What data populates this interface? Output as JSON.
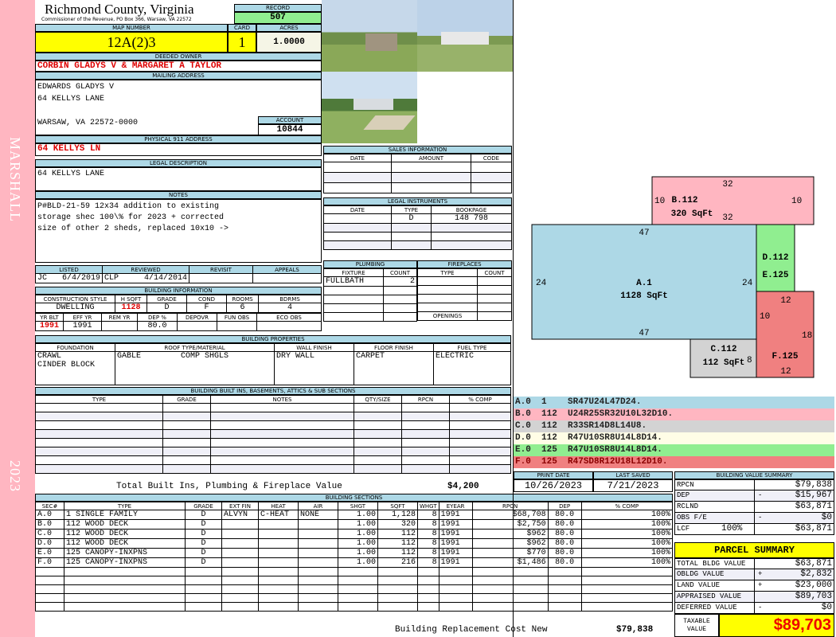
{
  "side": {
    "top": "MARSHALL",
    "bottom": "2023"
  },
  "header": {
    "title": "Richmond County, Virginia",
    "subtitle": "Commissioner of the Revenue, PO Box 366, Warsaw, VA 22572",
    "record_label": "RECORD",
    "record": "507"
  },
  "parcel": {
    "map_label": "MAP NUMBER",
    "map": "12A(2)3",
    "card_label": "CARD",
    "card": "1",
    "acres_label": "ACRES",
    "acres": "1.0000"
  },
  "owner": {
    "label": "DEEDED OWNER",
    "name": "CORBIN GLADYS V & MARGARET A TAYLOR"
  },
  "mailing": {
    "label": "MAILING ADDRESS",
    "line1": "EDWARDS GLADYS V",
    "line2": "64 KELLYS LANE",
    "line3": "WARSAW, VA 22572-0000",
    "account_label": "ACCOUNT",
    "account": "10844"
  },
  "physical": {
    "label": "PHYSICAL 911 ADDRESS",
    "value": "64 KELLYS LN"
  },
  "legal": {
    "label": "LEGAL DESCRIPTION",
    "value": "64 KELLYS LANE"
  },
  "notes": {
    "label": "NOTES",
    "lines": [
      "P#BLD-21-59 12x34 addition to existing",
      "storage shec 100\\% for 2023 + corrected",
      "size of other 2 sheds, replaced 10x10 ->"
    ]
  },
  "review": {
    "listed_label": "LISTED",
    "listed_by": "JC",
    "listed_date": "6/4/2019",
    "reviewed_label": "REVIEWED",
    "reviewed_by": "CLP",
    "reviewed_date": "4/14/2014",
    "revisit_label": "REVISIT",
    "appeals_label": "APPEALS"
  },
  "building_info": {
    "label": "BUILDING INFORMATION",
    "headers1": [
      "CONSTRUCTION STYLE",
      "H SQFT",
      "GRADE",
      "COND",
      "ROOMS",
      "BDRMS"
    ],
    "values1": [
      "DWELLING",
      "1128",
      "D",
      "F",
      "6",
      "4"
    ],
    "headers2": [
      "YR BLT",
      "EFF YR",
      "REM YR",
      "DEP %",
      "DEPOVR",
      "FUN OBS",
      "ECO OBS"
    ],
    "values2": [
      "1991",
      "1991",
      "",
      "80.0",
      "",
      "",
      ""
    ]
  },
  "properties": {
    "label": "BUILDING PROPERTIES",
    "headers": [
      "FOUNDATION",
      "ROOF TYPE/MATERIAL",
      "WALL FINISH",
      "FLOOR FINISH",
      "FUEL TYPE"
    ],
    "foundation": [
      "CRAWL",
      "CINDER BLOCK"
    ],
    "roof_type": "GABLE",
    "roof_material": "COMP SHGLS",
    "wall": "DRY WALL",
    "floor": "CARPET",
    "fuel": "ELECTRIC"
  },
  "builtins": {
    "label": "BUILDING BUILT INS, BASEMENTS, ATTICS & SUB SECTIONS",
    "headers": [
      "TYPE",
      "GRADE",
      "NOTES",
      "QTY/SIZE",
      "RPCN",
      "% COMP"
    ],
    "total_label": "Total Built Ins, Plumbing & Fireplace Value",
    "total": "$4,200"
  },
  "sections": {
    "label": "BUILDING SECTIONS",
    "headers": [
      "SEC#",
      "TYPE",
      "GRADE",
      "EXT FIN",
      "HEAT",
      "AIR",
      "SHGT",
      "SQFT",
      "WHGT",
      "EYEAR",
      "RPCN",
      "DEP",
      "% COMP"
    ],
    "rows": [
      [
        "A.0",
        "1 SINGLE FAMILY",
        "D",
        "ALVYN",
        "C-HEAT",
        "NONE",
        "1.00",
        "1,128",
        "8",
        "1991",
        "$68,708",
        "80.0",
        "100%"
      ],
      [
        "B.0",
        "112 WOOD DECK",
        "D",
        "",
        "",
        "",
        "1.00",
        "320",
        "8",
        "1991",
        "$2,750",
        "80.0",
        "100%"
      ],
      [
        "C.0",
        "112 WOOD DECK",
        "D",
        "",
        "",
        "",
        "1.00",
        "112",
        "8",
        "1991",
        "$962",
        "80.0",
        "100%"
      ],
      [
        "D.0",
        "112 WOOD DECK",
        "D",
        "",
        "",
        "",
        "1.00",
        "112",
        "8",
        "1991",
        "$962",
        "80.0",
        "100%"
      ],
      [
        "E.0",
        "125 CANOPY-INXPNS",
        "D",
        "",
        "",
        "",
        "1.00",
        "112",
        "8",
        "1991",
        "$770",
        "80.0",
        "100%"
      ],
      [
        "F.0",
        "125 CANOPY-INXPNS",
        "D",
        "",
        "",
        "",
        "1.00",
        "216",
        "8",
        "1991",
        "$1,486",
        "80.0",
        "100%"
      ]
    ],
    "total_label": "Building Replacement Cost New",
    "total": "$79,838"
  },
  "sales": {
    "label": "SALES INFORMATION",
    "headers": [
      "DATE",
      "AMOUNT",
      "CODE"
    ]
  },
  "instruments": {
    "label": "LEGAL INSTRUMENTS",
    "headers": [
      "DATE",
      "TYPE",
      "BOOKPAGE"
    ],
    "rows": [
      [
        "",
        "D",
        "148 798"
      ]
    ]
  },
  "plumbing": {
    "label": "PLUMBING",
    "headers": [
      "FIXTURE",
      "COUNT"
    ],
    "rows": [
      [
        "FULLBATH",
        "2"
      ]
    ]
  },
  "fireplaces": {
    "label": "FIREPLACES",
    "headers": [
      "TYPE",
      "COUNT"
    ],
    "openings_label": "OPENINGS"
  },
  "sketch": {
    "A": {
      "name": "A.1",
      "area": "1128 SqFt",
      "dims": [
        "47",
        "24",
        "24",
        "47"
      ]
    },
    "B": {
      "name": "B.112",
      "area": "320 SqFt",
      "dims": [
        "32",
        "10",
        "10",
        "32"
      ]
    },
    "C": {
      "name": "C.112",
      "area": "112 SqFt",
      "dims": [
        "8"
      ]
    },
    "DE": {
      "d": "D.112",
      "e": "E.125"
    },
    "F": {
      "name": "F.125",
      "dims": [
        "12",
        "10",
        "18",
        "12"
      ]
    }
  },
  "section_codes": [
    {
      "sec": "A.0",
      "code": "1",
      "path": "SR47U24L47D24.",
      "color": "#add8e6"
    },
    {
      "sec": "B.0",
      "code": "112",
      "path": "U24R25SR32U10L32D10.",
      "color": "#ffb6c1"
    },
    {
      "sec": "C.0",
      "code": "112",
      "path": "R33SR14D8L14U8.",
      "color": "#d3d3d3"
    },
    {
      "sec": "D.0",
      "code": "112",
      "path": "R47U10SR8U14L8D14.",
      "color": "#fffde6"
    },
    {
      "sec": "E.0",
      "code": "125",
      "path": "R47U10SR8U14L8D14.",
      "color": "#90ee90"
    },
    {
      "sec": "F.0",
      "code": "125",
      "path": "R47SD8R12U18L12D10.",
      "color": "#f08080"
    }
  ],
  "dates": {
    "print_label": "PRINT DATE",
    "print": "10/26/2023",
    "saved_label": "LAST SAVED",
    "saved": "7/21/2023"
  },
  "value_summary": {
    "label": "BUILDING VALUE SUMMARY",
    "rows": [
      {
        "label": "RPCN",
        "sign": "",
        "value": "$79,838"
      },
      {
        "label": "DEP",
        "sign": "-",
        "value": "$15,967"
      },
      {
        "label": "RCLND",
        "sign": "",
        "value": "$63,871"
      },
      {
        "label": "OBS F/E",
        "sign": "-",
        "value": "$0"
      },
      {
        "label": "LCF",
        "pct": "100%",
        "sign": "",
        "value": "$63,871"
      }
    ]
  },
  "parcel_summary": {
    "label": "PARCEL SUMMARY",
    "rows": [
      {
        "label": "TOTAL BLDG VALUE",
        "sign": "",
        "value": "$63,871"
      },
      {
        "label": "OBLDG VALUE",
        "sign": "+",
        "value": "$2,832"
      },
      {
        "label": "LAND VALUE",
        "sign": "+",
        "value": "$23,000"
      },
      {
        "label": "APPRAISED VALUE",
        "sign": "",
        "value": "$89,703"
      },
      {
        "label": "DEFERRED VALUE",
        "sign": "-",
        "value": "$0"
      }
    ],
    "taxable_label": "TAXABLE VALUE",
    "taxable": "$89,703"
  }
}
